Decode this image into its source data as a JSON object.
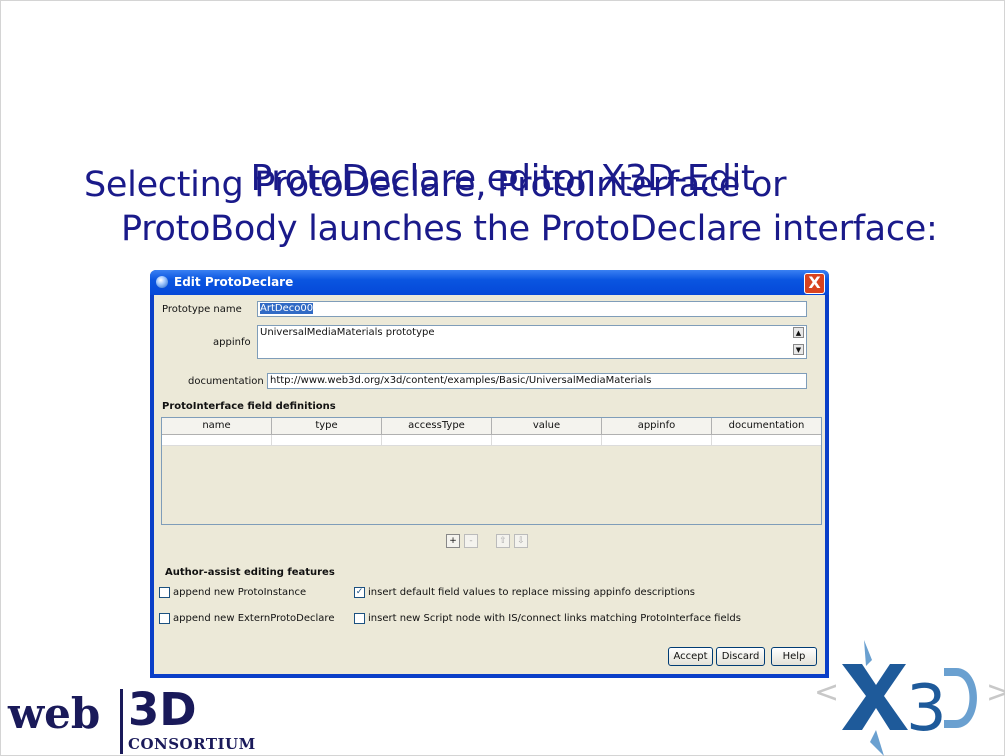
{
  "slide": {
    "title": "ProtoDeclare editor X3D-Edit",
    "bullet_line1": "Selecting ProtoDeclare, ProtoInterface or",
    "bullet_line2": "ProtoBody launches the ProtoDeclare interface:"
  },
  "dialog": {
    "title": "Edit ProtoDeclare",
    "close_label": "X",
    "prototype_name_label": "Prototype name",
    "prototype_name_value": "ArtDeco00",
    "appinfo_label": "appinfo",
    "appinfo_value": "UniversalMediaMaterials prototype",
    "documentation_label": "documentation",
    "documentation_value": "http://www.web3d.org/x3d/content/examples/Basic/UniversalMediaMaterials",
    "fields_section": "ProtoInterface field definitions",
    "columns": [
      "name",
      "type",
      "accessType",
      "value",
      "appinfo",
      "documentation"
    ],
    "table_buttons": {
      "add": "+",
      "remove": "-",
      "up": "⇧",
      "down": "⇩"
    },
    "author_section": "Author-assist editing features",
    "options": [
      {
        "label": "append new ProtoInstance",
        "checked": false
      },
      {
        "label": "insert default field values to replace missing appinfo descriptions",
        "checked": true
      },
      {
        "label": "append new ExternProtoDeclare",
        "checked": false
      },
      {
        "label": "insert new Script node with IS/connect links matching ProtoInterface fields",
        "checked": false
      }
    ],
    "buttons": {
      "accept": "Accept",
      "discard": "Discard",
      "help": "Help"
    }
  },
  "logos": {
    "web3d_left": "web",
    "web3d_right": "3D",
    "web3d_sub": "CONSORTIUM",
    "x3d": "X3D"
  },
  "colors": {
    "slide_text": "#1a1a8a",
    "title_bar": "#0a55e0",
    "dialog_bg": "#ece9d8"
  }
}
